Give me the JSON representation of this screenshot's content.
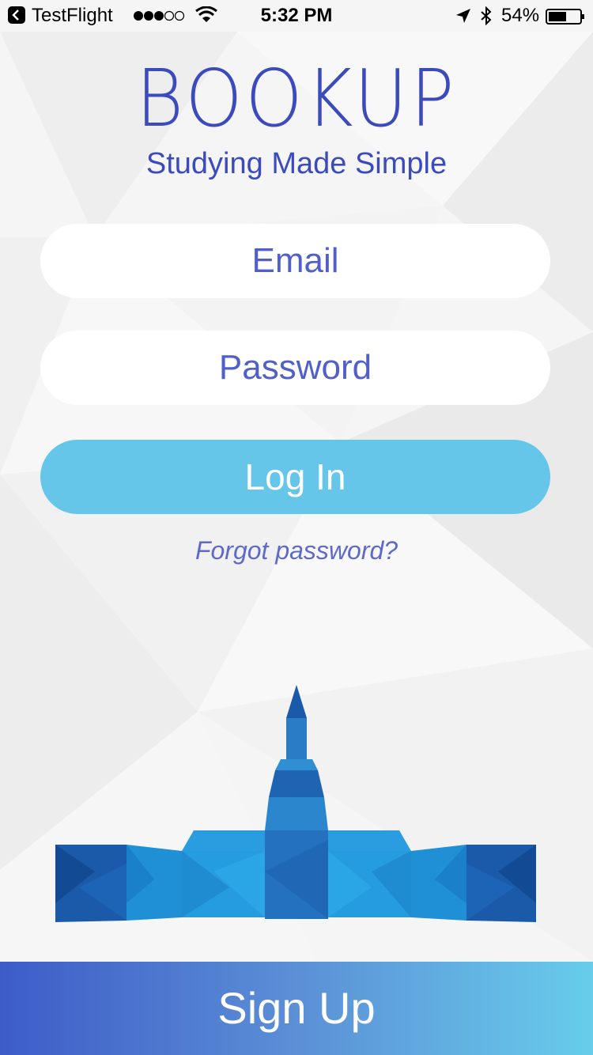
{
  "status_bar": {
    "carrier": "TestFlight",
    "time": "5:32 PM",
    "battery": "54%",
    "icons": [
      "back-arrow-icon",
      "signal-dots-icon",
      "wifi-icon",
      "location-arrow-icon",
      "bluetooth-icon",
      "battery-icon"
    ]
  },
  "brand": {
    "title": "BOOKUP",
    "subtitle": "Studying Made Simple",
    "accent": "#3b4bbd"
  },
  "login_form": {
    "email_placeholder": "Email",
    "password_placeholder": "Password",
    "login_label": "Log In",
    "forgot_label": "Forgot password?",
    "button_color": "#66c6e9"
  },
  "illustration": {
    "icon": "low-poly-building-icon"
  },
  "footer": {
    "signup_label": "Sign Up",
    "gradient_start": "#3e5cc8",
    "gradient_end": "#67cdeb"
  }
}
